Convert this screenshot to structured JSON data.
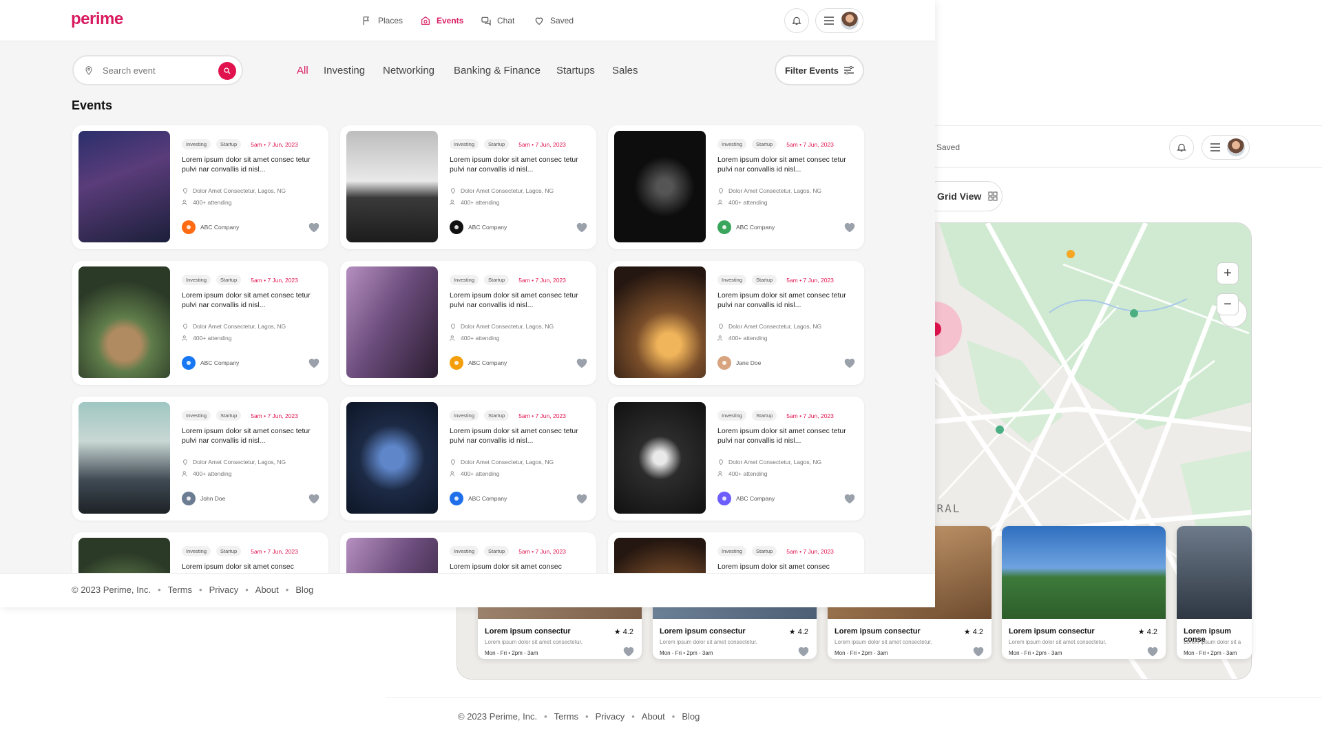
{
  "brand": {
    "logo": "perime"
  },
  "nav": [
    {
      "label": "Places",
      "icon": "places-icon",
      "active": false
    },
    {
      "label": "Events",
      "icon": "events-icon",
      "active": true
    },
    {
      "label": "Chat",
      "icon": "chat-icon",
      "active": false
    },
    {
      "label": "Saved",
      "icon": "heart-icon",
      "active": false
    }
  ],
  "search": {
    "placeholder": "Search event"
  },
  "categories": [
    "All",
    "Investing",
    "Networking",
    "Banking & Finance",
    "Startups",
    "Sales"
  ],
  "filter": {
    "label": "Filter Events"
  },
  "section_title": "Events",
  "events": [
    {
      "tags": [
        "Investing",
        "Startup"
      ],
      "date": "5am • 7 Jun, 2023",
      "title": "Lorem ipsum dolor sit amet consec tetur pulvi nar convallis id nisl...",
      "location": "Dolor Amet Consectetur, Lagos, NG",
      "attending": "400+ attending",
      "org": "ABC Company"
    },
    {
      "tags": [
        "Investing",
        "Startup"
      ],
      "date": "5am • 7 Jun, 2023",
      "title": "Lorem ipsum dolor sit amet consec tetur pulvi nar convallis id nisl...",
      "location": "Dolor Amet Consectetur, Lagos, NG",
      "attending": "400+ attending",
      "org": "ABC Company"
    },
    {
      "tags": [
        "Investing",
        "Startup"
      ],
      "date": "5am • 7 Jun, 2023",
      "title": "Lorem ipsum dolor sit amet consec tetur pulvi nar convallis id nisl...",
      "location": "Dolor Amet Consectetur, Lagos, NG",
      "attending": "400+ attending",
      "org": "ABC Company"
    },
    {
      "tags": [
        "Investing",
        "Startup"
      ],
      "date": "5am • 7 Jun, 2023",
      "title": "Lorem ipsum dolor sit amet consec tetur pulvi nar convallis id nisl...",
      "location": "Dolor Amet Consectetur, Lagos, NG",
      "attending": "400+ attending",
      "org": "ABC Company"
    },
    {
      "tags": [
        "Investing",
        "Startup"
      ],
      "date": "5am • 7 Jun, 2023",
      "title": "Lorem ipsum dolor sit amet consec tetur pulvi nar convallis id nisl...",
      "location": "Dolor Amet Consectetur, Lagos, NG",
      "attending": "400+ attending",
      "org": "ABC Company"
    },
    {
      "tags": [
        "Investing",
        "Startup"
      ],
      "date": "5am • 7 Jun, 2023",
      "title": "Lorem ipsum dolor sit amet consec tetur pulvi nar convallis id nisl...",
      "location": "Dolor Amet Consectetur, Lagos, NG",
      "attending": "400+ attending",
      "org": "Jane Doe"
    },
    {
      "tags": [
        "Investing",
        "Startup"
      ],
      "date": "5am • 7 Jun, 2023",
      "title": "Lorem ipsum dolor sit amet consec tetur pulvi nar convallis id nisl...",
      "location": "Dolor Amet Consectetur, Lagos, NG",
      "attending": "400+ attending",
      "org": "John Doe"
    },
    {
      "tags": [
        "Investing",
        "Startup"
      ],
      "date": "5am • 7 Jun, 2023",
      "title": "Lorem ipsum dolor sit amet consec tetur pulvi nar convallis id nisl...",
      "location": "Dolor Amet Consectetur, Lagos, NG",
      "attending": "400+ attending",
      "org": "ABC Company"
    },
    {
      "tags": [
        "Investing",
        "Startup"
      ],
      "date": "5am • 7 Jun, 2023",
      "title": "Lorem ipsum dolor sit amet consec tetur pulvi nar convallis id nisl...",
      "location": "Dolor Amet Consectetur, Lagos, NG",
      "attending": "400+ attending",
      "org": "ABC Company"
    },
    {
      "tags": [
        "Investing",
        "Startup"
      ],
      "date": "5am • 7 Jun, 2023",
      "title": "Lorem ipsum dolor sit amet consec",
      "location": "",
      "attending": "",
      "org": ""
    },
    {
      "tags": [
        "Investing",
        "Startup"
      ],
      "date": "5am • 7 Jun, 2023",
      "title": "Lorem ipsum dolor sit amet consec",
      "location": "",
      "attending": "",
      "org": ""
    },
    {
      "tags": [
        "Investing",
        "Startup"
      ],
      "date": "5am • 7 Jun, 2023",
      "title": "Lorem ipsum dolor sit amet consec",
      "location": "",
      "attending": "",
      "org": ""
    }
  ],
  "footer": {
    "copyright": "© 2023 Perime, Inc.",
    "links": [
      "Terms",
      "Privacy",
      "About",
      "Blog"
    ]
  },
  "map_view": {
    "saved_label": "Saved",
    "grid_view_label": "Grid View",
    "map_labels": [
      "CENTRAL"
    ],
    "places": [
      {
        "title": "Lorem ipsum consectur",
        "rating": "★ 4.2",
        "desc": "Lorem ipsum dolor sit amet consectetur.",
        "hours": "Mon - Fri  •  2pm - 3am"
      },
      {
        "title": "Lorem ipsum consectur",
        "rating": "★ 4.2",
        "desc": "Lorem ipsum dolor sit amet consectetur.",
        "hours": "Mon - Fri  •  2pm - 3am"
      },
      {
        "title": "Lorem ipsum consectur",
        "rating": "★ 4.2",
        "desc": "Lorem ipsum dolor sit amet consectetur.",
        "hours": "Mon - Fri  •  2pm - 3am"
      },
      {
        "title": "Lorem ipsum consectur",
        "rating": "★ 4.2",
        "desc": "Lorem ipsum dolor sit amet consectetur.",
        "hours": "Mon - Fri  •  2pm - 3am"
      },
      {
        "title": "Lorem ipsum conse",
        "rating": "",
        "desc": "Lorem ipsum dolor sit a",
        "hours": "Mon - Fri  •  2pm - 3am"
      }
    ]
  },
  "colors": {
    "accent": "#e0134e",
    "brand": "#d81b60",
    "page_bg": "#f5f5f5",
    "heart": "#9aa1ab"
  }
}
